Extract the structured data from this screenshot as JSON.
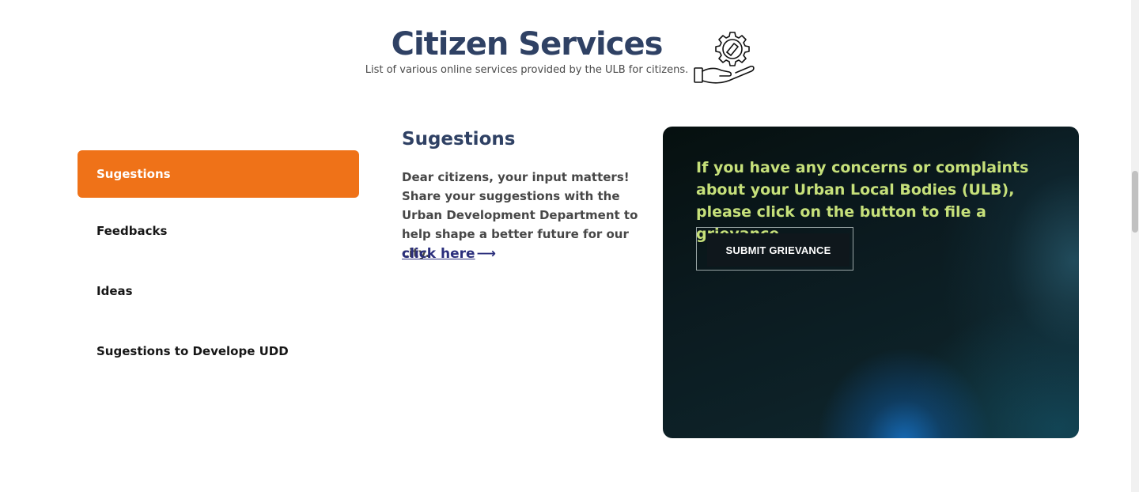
{
  "header": {
    "title": "Citizen Services",
    "subtitle": "List of various online services provided by the ULB for citizens.",
    "icon": "hand-gear-icon"
  },
  "sidebar": {
    "items": [
      {
        "label": "Sugestions",
        "active": true
      },
      {
        "label": "Feedbacks",
        "active": false
      },
      {
        "label": "Ideas",
        "active": false
      },
      {
        "label": "Sugestions to Develope UDD",
        "active": false
      }
    ]
  },
  "content": {
    "title": "Sugestions",
    "body": "Dear citizens, your input matters! Share your suggestions with the Urban Development Department to help shape a better future for our city.",
    "link_label": "click here",
    "link_arrow": "⟶"
  },
  "grievance": {
    "text": "If you have any concerns or complaints about your Urban Local Bodies (ULB), please click on the button to file a grievance.",
    "button_label": "SUBMIT GRIEVANCE"
  },
  "colors": {
    "accent": "#ef7218",
    "heading": "#2f4164",
    "grievance_text": "#c6e07a",
    "link": "#2b2f7c"
  }
}
